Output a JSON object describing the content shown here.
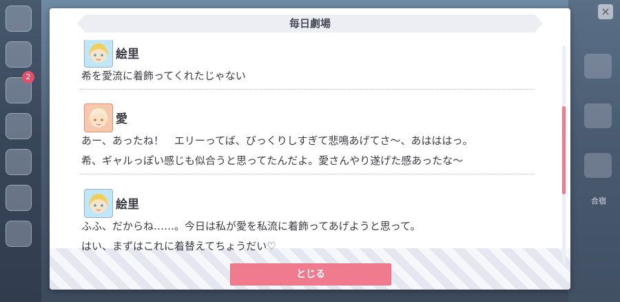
{
  "dialog": {
    "title": "毎日劇場",
    "close_label": "とじる"
  },
  "messages": [
    {
      "speaker": "絵里",
      "avatar": "eri-avatar",
      "lines": [
        "希を愛流に着飾ってくれたじゃない"
      ]
    },
    {
      "speaker": "愛",
      "avatar": "ai-avatar",
      "lines": [
        "あー、あったね！　エリーってば、びっくりしすぎて悲鳴あげてさ〜、あはははっ。",
        "希、ギャルっぽい感じも似合うと思ってたんだよ。愛さんやり遂げた感あったな〜"
      ]
    },
    {
      "speaker": "絵里",
      "avatar": "eri-avatar",
      "lines": [
        "ふふ、だからね……。今日は私が愛を私流に着飾ってあげようと思って。",
        "はい、まずはこれに着替えてちょうだい♡"
      ]
    }
  ],
  "background": {
    "badge_count": "2",
    "close_glyph": "×",
    "right_tag": "合宿"
  },
  "colors": {
    "accent": "#f07a8e",
    "title_bar": "#eceef4",
    "text": "#3a3a44"
  }
}
